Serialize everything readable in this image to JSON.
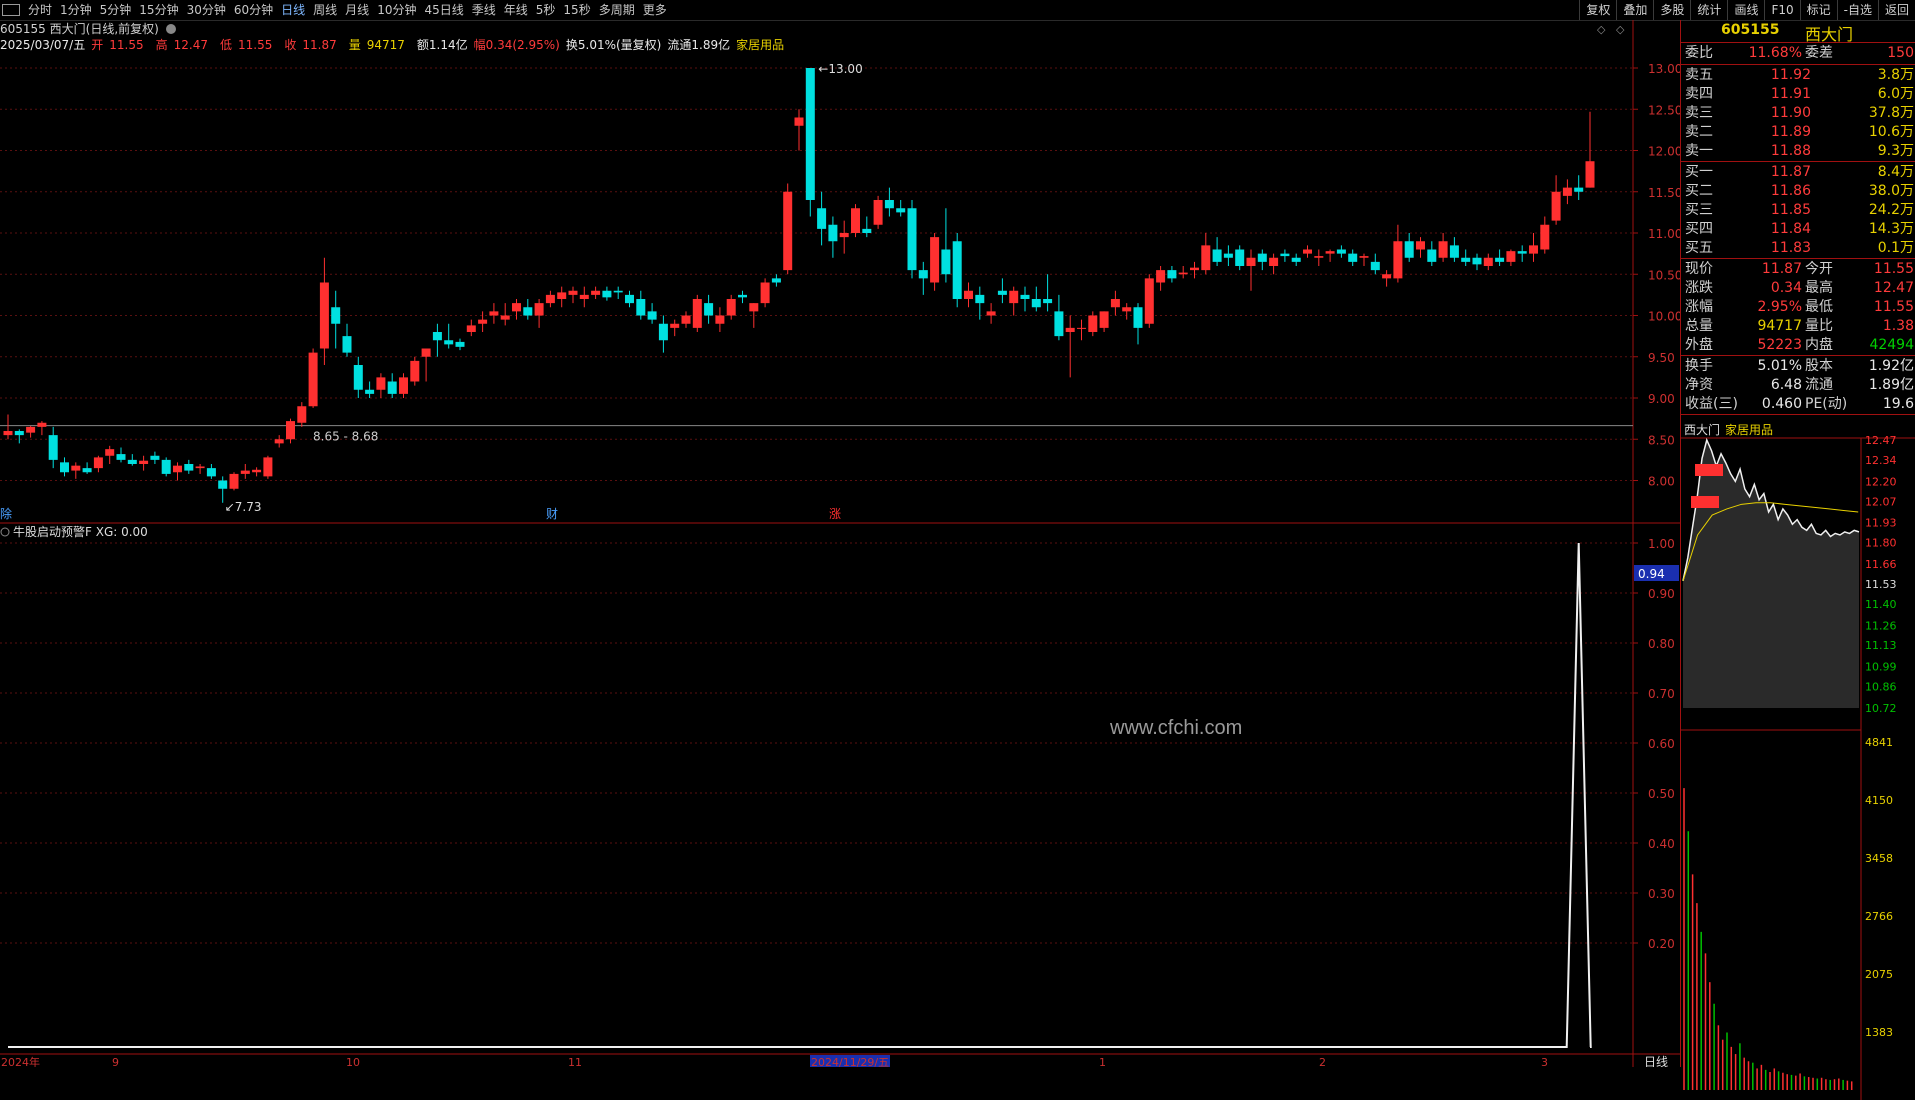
{
  "toolbar": {
    "periods": [
      "分时",
      "1分钟",
      "5分钟",
      "15分钟",
      "30分钟",
      "60分钟",
      "日线",
      "周线",
      "月线",
      "10分钟",
      "45日线",
      "季线",
      "年线",
      "5秒",
      "15秒",
      "多周期",
      "更多"
    ],
    "active_period": "日线",
    "tools": [
      "复权",
      "叠加",
      "多股",
      "统计",
      "画线",
      "F10",
      "标记",
      "-自选",
      "返回"
    ]
  },
  "stock": {
    "code": "605155",
    "name": "西大门",
    "mode": "(日线,前复权)",
    "date": "2025/03/07/五",
    "open_label": "开",
    "open": "11.55",
    "high_label": "高",
    "high": "12.47",
    "low_label": "低",
    "low": "11.55",
    "close_label": "收",
    "close": "11.87",
    "vol_label": "量",
    "vol": "94717",
    "amount": "额1.14亿",
    "change": "幅0.34(2.95%)",
    "turnover": "换5.01%(量复权)",
    "float": "流通1.89亿",
    "industry": "家居用品"
  },
  "chart_data": {
    "type": "candlestick",
    "yticks": [
      "13.00",
      "12.50",
      "12.00",
      "11.50",
      "11.00",
      "10.50",
      "10.00",
      "9.50",
      "9.00",
      "8.50",
      "8.00"
    ],
    "annotations": {
      "max": "13.00",
      "min": "7.73",
      "range": "8.65 - 8.68"
    },
    "markers": [
      "除",
      "财",
      "涨"
    ],
    "candles": [
      [
        8.55,
        8.8,
        8.5,
        8.6
      ],
      [
        8.6,
        8.62,
        8.45,
        8.55
      ],
      [
        8.58,
        8.66,
        8.52,
        8.65
      ],
      [
        8.65,
        8.72,
        8.55,
        8.7
      ],
      [
        8.55,
        8.65,
        8.15,
        8.25
      ],
      [
        8.22,
        8.28,
        8.05,
        8.1
      ],
      [
        8.12,
        8.22,
        8.02,
        8.18
      ],
      [
        8.15,
        8.22,
        8.08,
        8.1
      ],
      [
        8.15,
        8.3,
        8.1,
        8.28
      ],
      [
        8.3,
        8.42,
        8.2,
        8.38
      ],
      [
        8.32,
        8.4,
        8.22,
        8.25
      ],
      [
        8.25,
        8.32,
        8.18,
        8.2
      ],
      [
        8.2,
        8.3,
        8.12,
        8.24
      ],
      [
        8.3,
        8.35,
        8.2,
        8.25
      ],
      [
        8.25,
        8.28,
        8.05,
        8.08
      ],
      [
        8.1,
        8.22,
        8.0,
        8.18
      ],
      [
        8.2,
        8.25,
        8.08,
        8.12
      ],
      [
        8.15,
        8.2,
        8.08,
        8.17
      ],
      [
        8.15,
        8.2,
        8.02,
        8.05
      ],
      [
        8.0,
        8.05,
        7.73,
        7.9
      ],
      [
        7.9,
        8.1,
        7.88,
        8.08
      ],
      [
        8.08,
        8.2,
        8.02,
        8.12
      ],
      [
        8.1,
        8.16,
        8.05,
        8.13
      ],
      [
        8.05,
        8.3,
        8.02,
        8.28
      ],
      [
        8.45,
        8.55,
        8.4,
        8.5
      ],
      [
        8.5,
        8.75,
        8.45,
        8.72
      ],
      [
        8.7,
        8.95,
        8.65,
        8.9
      ],
      [
        8.9,
        9.6,
        8.88,
        9.55
      ],
      [
        9.6,
        10.7,
        9.4,
        10.4
      ],
      [
        10.1,
        10.3,
        9.6,
        9.9
      ],
      [
        9.75,
        9.9,
        9.5,
        9.55
      ],
      [
        9.4,
        9.5,
        9.0,
        9.1
      ],
      [
        9.1,
        9.2,
        9.0,
        9.05
      ],
      [
        9.1,
        9.3,
        9.0,
        9.25
      ],
      [
        9.2,
        9.3,
        9.0,
        9.05
      ],
      [
        9.05,
        9.3,
        9.0,
        9.25
      ],
      [
        9.2,
        9.5,
        9.15,
        9.45
      ],
      [
        9.5,
        9.6,
        9.2,
        9.6
      ],
      [
        9.8,
        9.9,
        9.5,
        9.7
      ],
      [
        9.7,
        9.9,
        9.6,
        9.65
      ],
      [
        9.68,
        9.72,
        9.58,
        9.62
      ],
      [
        9.8,
        9.95,
        9.75,
        9.88
      ],
      [
        9.9,
        10.05,
        9.8,
        9.95
      ],
      [
        10.0,
        10.15,
        9.9,
        10.05
      ],
      [
        9.95,
        10.15,
        9.88,
        10.0
      ],
      [
        10.05,
        10.2,
        9.95,
        10.15
      ],
      [
        10.1,
        10.2,
        9.95,
        10.0
      ],
      [
        10.0,
        10.2,
        9.85,
        10.15
      ],
      [
        10.15,
        10.3,
        10.1,
        10.25
      ],
      [
        10.2,
        10.35,
        10.1,
        10.28
      ],
      [
        10.25,
        10.35,
        10.15,
        10.3
      ],
      [
        10.2,
        10.35,
        10.1,
        10.25
      ],
      [
        10.25,
        10.35,
        10.2,
        10.3
      ],
      [
        10.3,
        10.35,
        10.18,
        10.22
      ],
      [
        10.3,
        10.35,
        10.2,
        10.28
      ],
      [
        10.25,
        10.3,
        10.1,
        10.15
      ],
      [
        10.2,
        10.3,
        9.95,
        10.0
      ],
      [
        10.05,
        10.15,
        9.9,
        9.95
      ],
      [
        9.9,
        10.0,
        9.55,
        9.7
      ],
      [
        9.85,
        9.95,
        9.75,
        9.9
      ],
      [
        9.9,
        10.05,
        9.85,
        10.0
      ],
      [
        9.85,
        10.25,
        9.8,
        10.2
      ],
      [
        10.15,
        10.25,
        9.9,
        10.0
      ],
      [
        9.9,
        10.1,
        9.8,
        10.0
      ],
      [
        10.0,
        10.25,
        9.95,
        10.2
      ],
      [
        10.25,
        10.3,
        10.15,
        10.22
      ],
      [
        10.05,
        10.15,
        9.85,
        10.15
      ],
      [
        10.15,
        10.45,
        10.1,
        10.4
      ],
      [
        10.45,
        10.5,
        10.35,
        10.4
      ],
      [
        10.55,
        11.6,
        10.5,
        11.5
      ],
      [
        12.3,
        12.5,
        12.0,
        12.4
      ],
      [
        13.0,
        13.0,
        11.2,
        11.4
      ],
      [
        11.3,
        11.5,
        10.85,
        11.05
      ],
      [
        11.1,
        11.2,
        10.7,
        10.9
      ],
      [
        10.95,
        11.15,
        10.75,
        11.0
      ],
      [
        11.0,
        11.35,
        10.95,
        11.3
      ],
      [
        11.05,
        11.2,
        10.95,
        11.0
      ],
      [
        11.1,
        11.45,
        11.05,
        11.4
      ],
      [
        11.4,
        11.55,
        11.2,
        11.3
      ],
      [
        11.3,
        11.4,
        11.2,
        11.25
      ],
      [
        11.3,
        11.4,
        10.45,
        10.55
      ],
      [
        10.55,
        10.65,
        10.25,
        10.45
      ],
      [
        10.4,
        11.0,
        10.3,
        10.95
      ],
      [
        10.8,
        11.3,
        10.4,
        10.5
      ],
      [
        10.9,
        11.0,
        10.1,
        10.2
      ],
      [
        10.2,
        10.4,
        10.1,
        10.3
      ],
      [
        10.25,
        10.35,
        9.95,
        10.15
      ],
      [
        10.0,
        10.15,
        9.9,
        10.05
      ],
      [
        10.3,
        10.45,
        10.15,
        10.25
      ],
      [
        10.15,
        10.35,
        10.0,
        10.3
      ],
      [
        10.25,
        10.35,
        10.05,
        10.2
      ],
      [
        10.2,
        10.35,
        10.05,
        10.1
      ],
      [
        10.2,
        10.5,
        10.05,
        10.15
      ],
      [
        10.05,
        10.25,
        9.7,
        9.75
      ],
      [
        9.8,
        10.0,
        9.25,
        9.85
      ],
      [
        9.85,
        9.95,
        9.7,
        9.85
      ],
      [
        9.8,
        10.05,
        9.75,
        10.0
      ],
      [
        9.85,
        10.05,
        9.8,
        10.05
      ],
      [
        10.1,
        10.3,
        10.0,
        10.2
      ],
      [
        10.05,
        10.15,
        9.95,
        10.1
      ],
      [
        10.1,
        10.15,
        9.65,
        9.85
      ],
      [
        9.9,
        10.5,
        9.85,
        10.45
      ],
      [
        10.4,
        10.6,
        10.3,
        10.55
      ],
      [
        10.55,
        10.6,
        10.4,
        10.45
      ],
      [
        10.5,
        10.6,
        10.45,
        10.52
      ],
      [
        10.55,
        10.65,
        10.45,
        10.58
      ],
      [
        10.55,
        11.0,
        10.5,
        10.85
      ],
      [
        10.8,
        10.95,
        10.6,
        10.65
      ],
      [
        10.75,
        10.85,
        10.6,
        10.7
      ],
      [
        10.8,
        10.85,
        10.55,
        10.6
      ],
      [
        10.6,
        10.8,
        10.3,
        10.7
      ],
      [
        10.75,
        10.8,
        10.55,
        10.65
      ],
      [
        10.6,
        10.75,
        10.5,
        10.7
      ],
      [
        10.75,
        10.8,
        10.65,
        10.72
      ],
      [
        10.7,
        10.75,
        10.6,
        10.65
      ],
      [
        10.75,
        10.85,
        10.7,
        10.8
      ],
      [
        10.7,
        10.8,
        10.6,
        10.72
      ],
      [
        10.75,
        10.8,
        10.65,
        10.78
      ],
      [
        10.8,
        10.85,
        10.7,
        10.75
      ],
      [
        10.75,
        10.8,
        10.6,
        10.65
      ],
      [
        10.7,
        10.75,
        10.6,
        10.72
      ],
      [
        10.65,
        10.75,
        10.5,
        10.55
      ],
      [
        10.45,
        10.55,
        10.35,
        10.5
      ],
      [
        10.45,
        11.1,
        10.4,
        10.9
      ],
      [
        10.9,
        11.0,
        10.65,
        10.7
      ],
      [
        10.8,
        10.95,
        10.7,
        10.9
      ],
      [
        10.8,
        10.9,
        10.6,
        10.65
      ],
      [
        10.7,
        11.0,
        10.65,
        10.9
      ],
      [
        10.85,
        10.95,
        10.65,
        10.7
      ],
      [
        10.7,
        10.8,
        10.6,
        10.65
      ],
      [
        10.7,
        10.75,
        10.55,
        10.62
      ],
      [
        10.6,
        10.75,
        10.55,
        10.7
      ],
      [
        10.7,
        10.8,
        10.6,
        10.65
      ],
      [
        10.65,
        10.8,
        10.6,
        10.78
      ],
      [
        10.78,
        10.85,
        10.65,
        10.75
      ],
      [
        10.75,
        11.0,
        10.65,
        10.85
      ],
      [
        10.8,
        11.2,
        10.75,
        11.1
      ],
      [
        11.15,
        11.7,
        11.1,
        11.5
      ],
      [
        11.45,
        11.65,
        11.35,
        11.55
      ],
      [
        11.55,
        11.7,
        11.4,
        11.5
      ],
      [
        11.55,
        12.47,
        11.55,
        11.87
      ]
    ],
    "indicator": {
      "name": "牛股启动预警F",
      "label": "XG: 0.00",
      "current": "0.94",
      "yticks": [
        "1.00",
        "0.90",
        "0.80",
        "0.70",
        "0.60",
        "0.50",
        "0.40",
        "0.30",
        "0.20"
      ],
      "spike_at_index": 139
    },
    "x_labels": [
      "2024年",
      "9",
      "10",
      "11",
      "2024/11/29/五",
      "1",
      "2",
      "3"
    ],
    "x_corner": "日线"
  },
  "panel": {
    "code": "605155",
    "name": "西大门",
    "weibi_label": "委比",
    "weibi": "11.68%",
    "weicha_label": "委差",
    "weicha": "150",
    "asks": [
      {
        "label": "卖五",
        "price": "11.92",
        "vol": "3.8万"
      },
      {
        "label": "卖四",
        "price": "11.91",
        "vol": "6.0万"
      },
      {
        "label": "卖三",
        "price": "11.90",
        "vol": "37.8万"
      },
      {
        "label": "卖二",
        "price": "11.89",
        "vol": "10.6万"
      },
      {
        "label": "卖一",
        "price": "11.88",
        "vol": "9.3万"
      }
    ],
    "bids": [
      {
        "label": "买一",
        "price": "11.87",
        "vol": "8.4万"
      },
      {
        "label": "买二",
        "price": "11.86",
        "vol": "38.0万"
      },
      {
        "label": "买三",
        "price": "11.85",
        "vol": "24.2万"
      },
      {
        "label": "买四",
        "price": "11.84",
        "vol": "14.3万"
      },
      {
        "label": "买五",
        "price": "11.83",
        "vol": "0.1万"
      }
    ],
    "stats": [
      {
        "l1": "现价",
        "v1": "11.87",
        "c1": "red",
        "l2": "今开",
        "v2": "11.55",
        "c2": "red"
      },
      {
        "l1": "涨跌",
        "v1": "0.34",
        "c1": "red",
        "l2": "最高",
        "v2": "12.47",
        "c2": "red"
      },
      {
        "l1": "涨幅",
        "v1": "2.95%",
        "c1": "red",
        "l2": "最低",
        "v2": "11.55",
        "c2": "red"
      },
      {
        "l1": "总量",
        "v1": "94717",
        "c1": "yel",
        "l2": "量比",
        "v2": "1.38",
        "c2": "red"
      },
      {
        "l1": "外盘",
        "v1": "52223",
        "c1": "red",
        "l2": "内盘",
        "v2": "42494",
        "c2": "grn"
      }
    ],
    "stats2": [
      {
        "l1": "换手",
        "v1": "5.01%",
        "l2": "股本",
        "v2": "1.92亿"
      },
      {
        "l1": "净资",
        "v1": "6.48",
        "l2": "流通",
        "v2": "1.89亿"
      },
      {
        "l1": "收益(三)",
        "v1": "0.460",
        "l2": "PE(动)",
        "v2": "19.6"
      }
    ],
    "mini": {
      "title": "西大门",
      "industry": "家居用品",
      "yticks": [
        "12.47",
        "12.34",
        "12.20",
        "12.07",
        "11.93",
        "11.80",
        "11.66",
        "11.53",
        "11.40",
        "11.26",
        "11.13",
        "10.99",
        "10.86",
        "10.72"
      ],
      "vticks": [
        "4841",
        "4150",
        "3458",
        "2766",
        "2075",
        "1383"
      ]
    }
  },
  "watermark": "www.cfchi.com"
}
